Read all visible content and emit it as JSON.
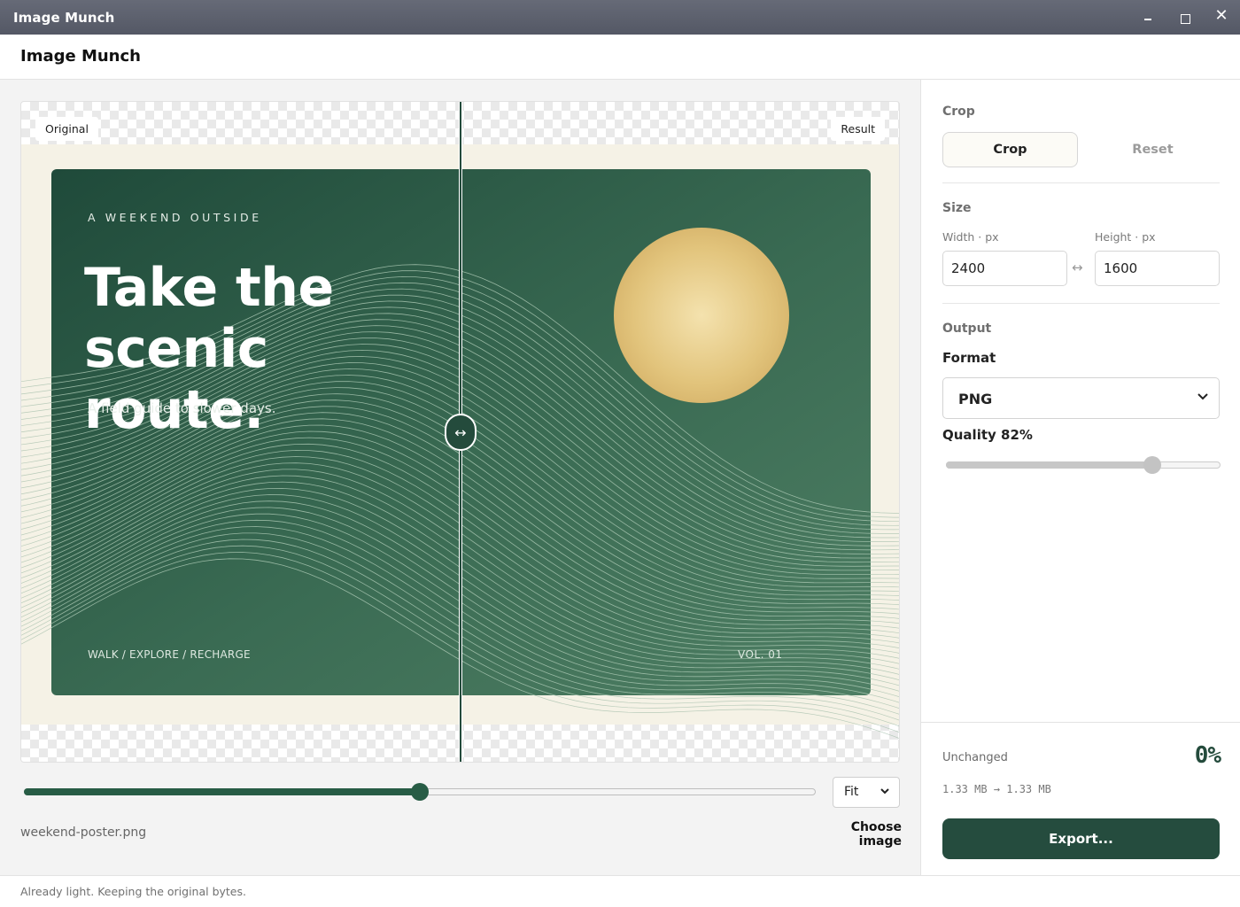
{
  "window": {
    "title": "Image Munch",
    "controls": {
      "minimize": "minimize-icon",
      "maximize": "maximize-icon",
      "close": "close-icon"
    }
  },
  "header": {
    "title": "Image Munch"
  },
  "viewer": {
    "label_left": "Original",
    "label_right": "Result",
    "handle_icon": "↔",
    "artwork": {
      "kicker": "A WEEKEND OUTSIDE",
      "title": "Take the scenic route.",
      "subtitle": "A field guide to slower days.",
      "footer_left": "WALK / EXPLORE / RECHARGE",
      "footer_right": "VOL. 01"
    },
    "compare_position": 0.5,
    "zoom": "Fit",
    "filename": "weekend-poster.png",
    "choose_label": "Choose image"
  },
  "sidebar": {
    "crop": {
      "section_label": "Crop",
      "crop_label": "Crop",
      "reset_label": "Reset"
    },
    "size": {
      "section_label": "Size",
      "width_label": "Width · px",
      "height_label": "Height · px",
      "width_value": "2400",
      "height_value": "1600",
      "link_icon": "↔"
    },
    "output": {
      "section_label": "Output",
      "format_label": "Format",
      "format_value": "PNG",
      "quality_label": "Quality 82%",
      "quality_value": 0.75
    },
    "summary": {
      "status": "Unchanged",
      "percent": "0%",
      "bytes": "1.33 MB → 1.33 MB",
      "export_label": "Export..."
    }
  },
  "statusbar": {
    "message": "Already light. Keeping the original bytes."
  },
  "colors": {
    "accent": "#254c3e",
    "poster_dark": "#1f4a3a",
    "poster_mid": "#3e6f58",
    "sun": "#e2c47c",
    "cream": "#f5f2e6"
  }
}
